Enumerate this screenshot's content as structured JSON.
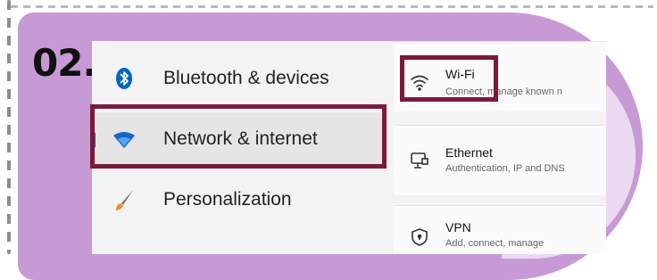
{
  "step_number": "02.",
  "colors": {
    "accent": "#0067c0",
    "highlight": "#7b1a36",
    "card_bg": "#c79ad6"
  },
  "sidebar": {
    "items": [
      {
        "label": "Bluetooth & devices",
        "icon": "bluetooth-icon",
        "selected": false
      },
      {
        "label": "Network & internet",
        "icon": "wifi-network-icon",
        "selected": true
      },
      {
        "label": "Personalization",
        "icon": "paintbrush-icon",
        "selected": false
      }
    ]
  },
  "network_panel": {
    "items": [
      {
        "title": "Wi-Fi",
        "subtitle": "Connect, manage known n",
        "icon": "wifi-icon"
      },
      {
        "title": "Ethernet",
        "subtitle": "Authentication, IP and DNS",
        "icon": "ethernet-icon"
      },
      {
        "title": "VPN",
        "subtitle": "Add, connect, manage",
        "icon": "vpn-shield-icon"
      }
    ]
  }
}
